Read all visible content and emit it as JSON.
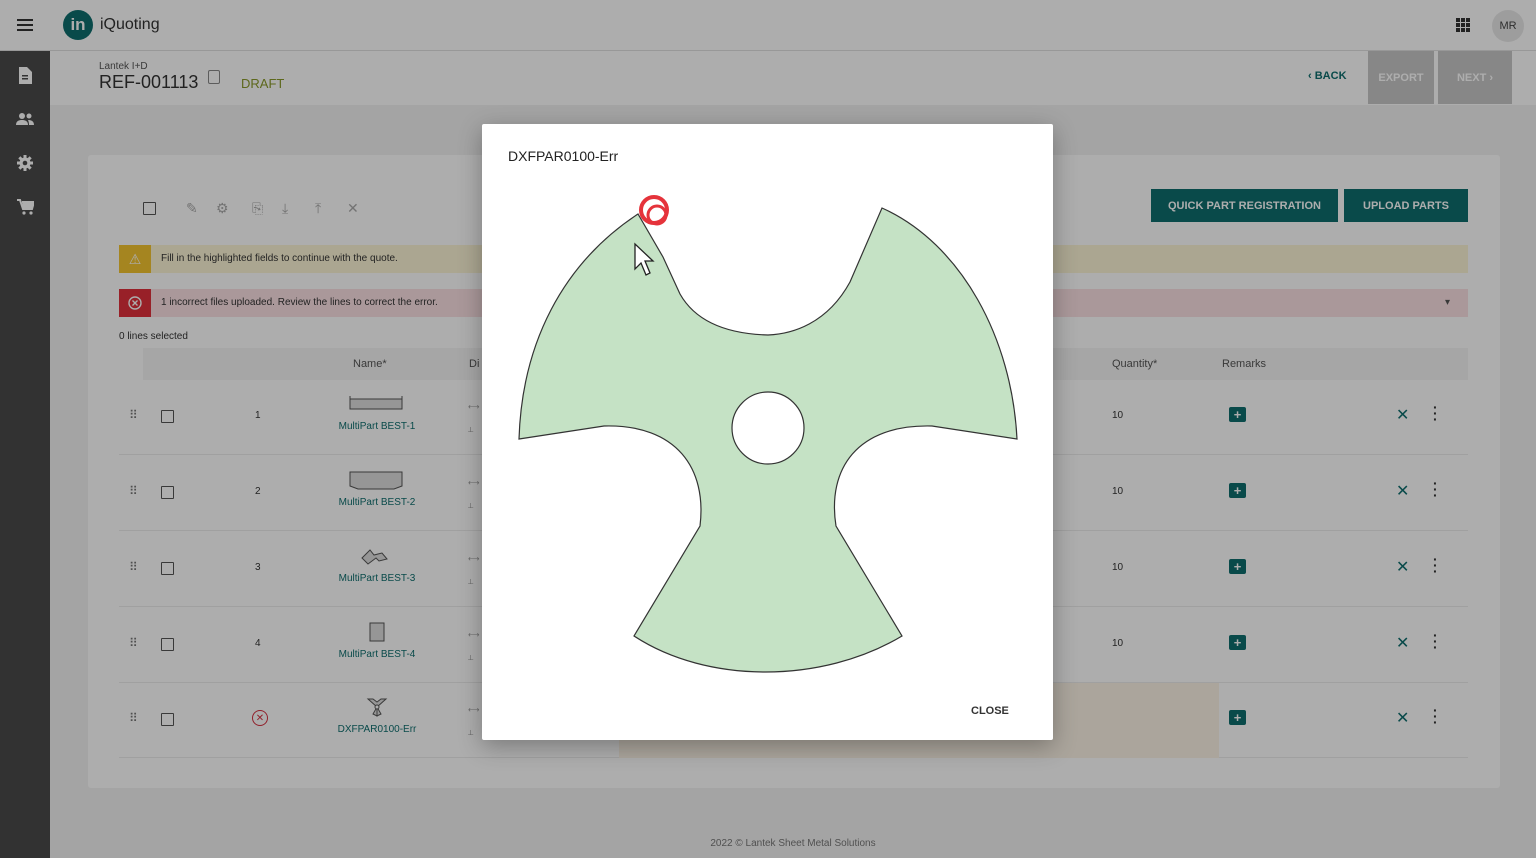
{
  "app": {
    "logo_text": "in",
    "title": "iQuoting",
    "user_initials": "MR"
  },
  "header": {
    "company": "Lantek I+D",
    "reference": "REF-001113",
    "status": "DRAFT",
    "back_label": "BACK",
    "export_label": "EXPORT",
    "next_label": "NEXT"
  },
  "toolbar": {
    "quick_part_registration_label": "QUICK PART REGISTRATION",
    "upload_parts_label": "UPLOAD PARTS"
  },
  "banners": {
    "warning": "Fill in the highlighted fields to continue with the quote.",
    "error": "1 incorrect files uploaded. Review the lines to correct the error."
  },
  "selection": {
    "count_text": "0 lines selected"
  },
  "table": {
    "headers": {
      "name": "Name*",
      "dimensions": "Di",
      "quantity": "Quantity*",
      "remarks": "Remarks"
    },
    "rows": [
      {
        "number": "1",
        "name": "MultiPart BEST-1",
        "quantity": "10",
        "error": false
      },
      {
        "number": "2",
        "name": "MultiPart BEST-2",
        "quantity": "10",
        "error": false
      },
      {
        "number": "3",
        "name": "MultiPart BEST-3",
        "quantity": "10",
        "error": false
      },
      {
        "number": "4",
        "name": "MultiPart BEST-4",
        "quantity": "10",
        "error": false
      },
      {
        "number": "",
        "name": "DXFPAR0100-Err",
        "quantity": "",
        "error": true
      }
    ]
  },
  "footer": {
    "text": "2022 © Lantek Sheet Metal Solutions"
  },
  "modal": {
    "title": "DXFPAR0100-Err",
    "close_label": "CLOSE",
    "part_fill": "#c5e2c5",
    "marker_color": "#e5333b"
  },
  "colors": {
    "brand": "#0e6e6e",
    "warning": "#f4c430",
    "error": "#e0303c",
    "sidebar": "#4a4a4a"
  }
}
